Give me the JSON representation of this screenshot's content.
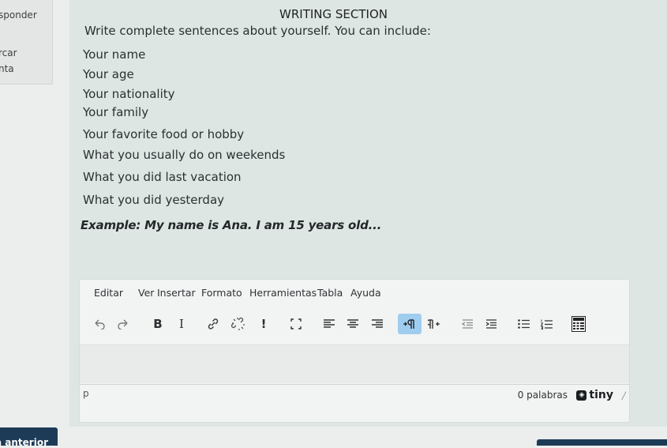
{
  "left_panel": {
    "item1": "sponder",
    "item2": "rcar",
    "item3": "nta"
  },
  "section": {
    "title": "WRITING SECTION",
    "intro": "Write complete sentences about yourself. You can include:",
    "items": [
      "Your name",
      "Your age",
      "Your nationality",
      "Your family",
      "Your favorite food or hobby",
      "What you usually do on weekends",
      "What you did last vacation",
      "What you did yesterday"
    ],
    "example": "Example: My name is Ana. I am 15 years old..."
  },
  "editor": {
    "menu": [
      "Editar",
      "Ver",
      "Insertar",
      "Formato",
      "Herramientas",
      "Tabla",
      "Ayuda"
    ],
    "toolbar": {
      "bold": "B",
      "italic": "I",
      "exclamation": "!"
    },
    "path": "p",
    "word_count": "0 palabras",
    "brand": "tiny"
  },
  "nav": {
    "previous_label": "a anterior"
  },
  "colors": {
    "accent": "#1d3b57",
    "active_button": "#9fcdf0"
  }
}
